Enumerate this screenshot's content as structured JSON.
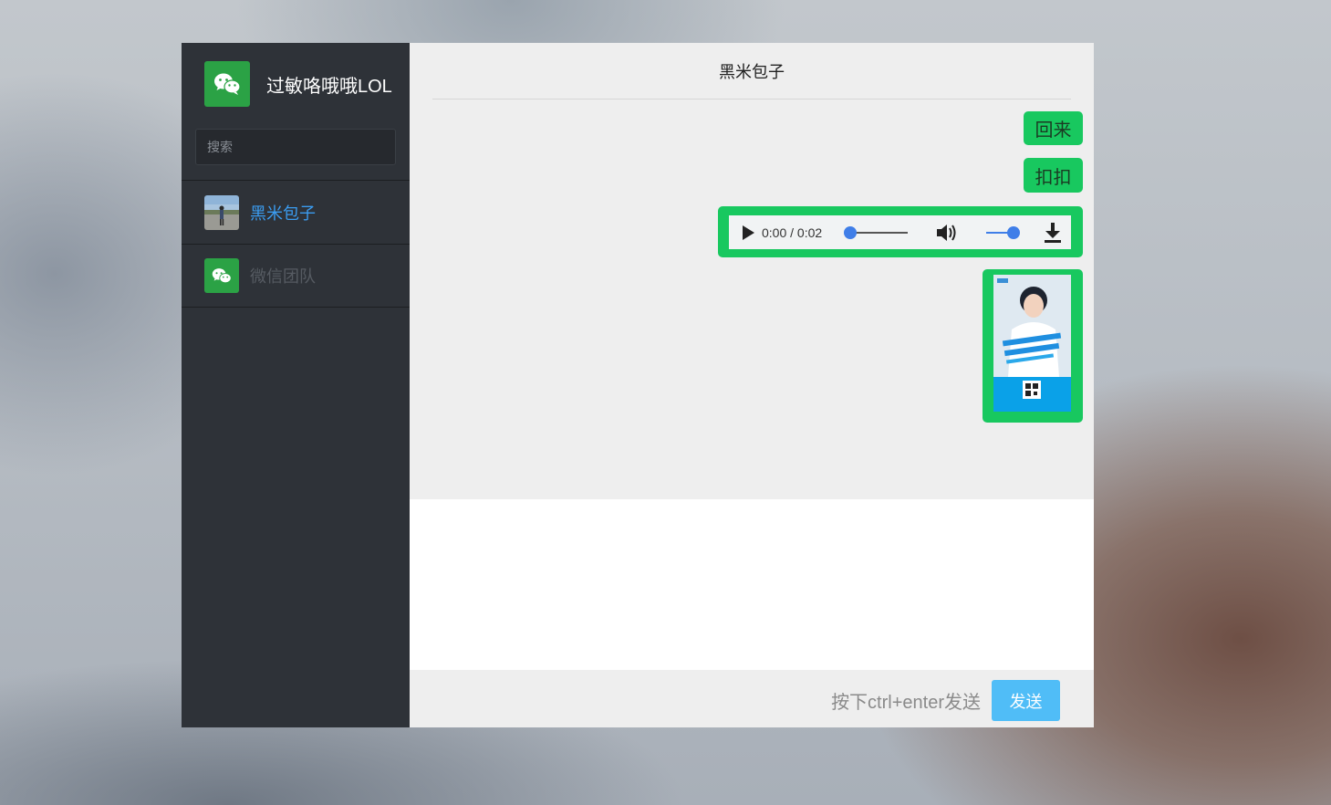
{
  "profile": {
    "name": "过敏咯哦哦LOL",
    "icon": "wechat-logo-icon"
  },
  "search": {
    "placeholder": "搜索"
  },
  "contacts": [
    {
      "name": "黑米包子",
      "active": true
    },
    {
      "name": "微信团队",
      "active": false
    }
  ],
  "chat": {
    "title": "黑米包子",
    "messages": [
      {
        "type": "text",
        "text": "回来"
      },
      {
        "type": "text",
        "text": "扣扣"
      },
      {
        "type": "audio",
        "time": "0:00 / 0:02",
        "progress": 0,
        "volume": 1
      },
      {
        "type": "image",
        "icon": "poster-image"
      }
    ]
  },
  "compose": {
    "value": ""
  },
  "footer": {
    "hint": "按下ctrl+enter发送",
    "send_label": "发送"
  },
  "colors": {
    "sidebar": "#2e3238",
    "wechat_green": "#2ba245",
    "bubble": "#18c85f",
    "active_contact": "#3b9cf0",
    "send_button": "#50bdf7"
  }
}
